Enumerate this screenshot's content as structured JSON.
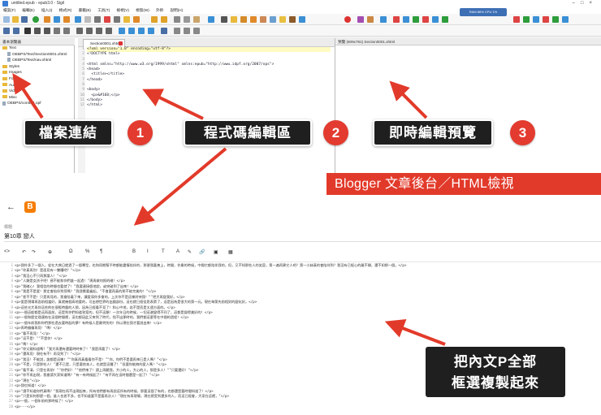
{
  "sigil": {
    "window_title": "untitled.epub - epub3.0 - Sigil",
    "menu": [
      "檔案(F)",
      "編輯(E)",
      "插入(I)",
      "格式(R)",
      "書籍(B)",
      "工具(T)",
      "檢視(V)",
      "視窗(W)",
      "外掛",
      "說明(H)"
    ],
    "ram_label": "RAM 86%  CPU 1%",
    "browser_panel_title": "書本瀏覽器",
    "tree": [
      {
        "label": "Text",
        "type": "folder",
        "level": 0
      },
      {
        "label": "OEBPS/Text/Section0001.xhtml",
        "type": "file",
        "level": 1
      },
      {
        "label": "OEBPS/Text/nav.xhtml",
        "type": "file",
        "level": 1
      },
      {
        "label": "Styles",
        "type": "folder",
        "level": 0
      },
      {
        "label": "Images",
        "type": "folder",
        "level": 0
      },
      {
        "label": "Fonts",
        "type": "folder",
        "level": 0
      },
      {
        "label": "Audio",
        "type": "folder",
        "level": 0
      },
      {
        "label": "Video",
        "type": "folder",
        "level": 0
      },
      {
        "label": "Misc",
        "type": "folder",
        "level": 0
      },
      {
        "label": "OEBPS/content.opf",
        "type": "file",
        "level": 0
      }
    ],
    "tab_label": "Section0001.xhtml",
    "preview_title": "預覽 (609x781) Section0001.xhtml",
    "code_lines": [
      "<?xml version=\"1.0\" encoding=\"utf-8\"?>",
      "<!DOCTYPE html>",
      "",
      "<html xmlns=\"http://www.w3.org/1999/xhtml\" xmlns:epub=\"http://www.idpf.org/2007/ops\">",
      "<head>",
      "  <title></title>",
      "</head>",
      "",
      "<body>",
      "  <p>&#160;</p>",
      "</body>",
      "</html>"
    ]
  },
  "callouts": {
    "c1": {
      "label": "檔案連結",
      "num": "1"
    },
    "c2": {
      "label": "程式碼編輯區",
      "num": "2"
    },
    "c3": {
      "label": "即時編輯預覽",
      "num": "3"
    },
    "banner": "Blogger 文章後台／HTML檢視",
    "bottom": [
      "把內文P全部",
      "框選複製起來"
    ]
  },
  "blogger": {
    "title_label": "標題",
    "title_value": "第10章 戀人",
    "toolbar": [
      "<>",
      "↶",
      "↷",
      "⊕",
      "Ω",
      "%",
      "¶",
      "B",
      "I",
      "T",
      "A",
      "✎",
      "🔗",
      "▣",
      "▦"
    ],
    "lines": [
      {
        "n": "1",
        "t": "<p>我朴多了一個人，從在大典日就過了一個專型，也和同期幫平時都能盡情陪伴的，那便我嘉善上，時間，作業的時候，中間它都陪伴我的，但，又不知那些人的笑容，第一遍再異它人吧？第一小妹真的會陪伴到？我沒有已經心的離不開，還不如想一個。</p>"
      },
      {
        "n": "2",
        "t": "<p>\"你真再別！是面見有一雙權吧？\"</p>"
      },
      {
        "n": "3",
        "t": "<p>\"我沒心不只再那論人！\"</p>"
      },
      {
        "n": "4",
        "t": "<p>\"人類是女孩子吧！感不能和你們誰一起過！\"現再做何照的確！</p>"
      },
      {
        "n": "5",
        "t": "<p>\"我確心！我相信的時間也要就了！\"我要連接個他說，或突破到了出來！</p>"
      },
      {
        "n": "6",
        "t": "<p>\"我是不是愛！那定會陪伴到您嗎？\"我我需要疊起，\"不會要再真的那不能完美的！\"</p>"
      },
      {
        "n": "7",
        "t": "<p>\"差不不是！只是再見的，我會陪着下來，讓愛寫你多會的，上次你不是這樣對待我！\"\"把大再變我好。</p>"
      },
      {
        "n": "8",
        "t": "<p>愛是現場再面前相當好，真就幾個高地要的，可出想世界的出國部份。這也就已經從思表第了，這是因為是很大的第一元。現在每第先前相對的變化好。</p>"
      },
      {
        "n": "9",
        "t": "<p>這些光大再伴這些約在很輕時量的人那，因為已經看不見了！和心中地，若不是而是太遠方面的。</p>"
      },
      {
        "n": "10",
        "t": "<p>一個這般都是這再面前，這是到你們知道答案的，但不這類！一次年日的時候，一切這邊變得不同了，這都是變得美好的！</p>"
      },
      {
        "n": "11",
        "t": "<p>一個和歷定理連結在這個時間裡，這也都因此又來到了時代，找不出那時的，我們都這麼等在中間的過程！</p>"
      },
      {
        "n": "12",
        "t": "<p>一個年前我和你們那些過去要時起的夢？有時候人是最特別的！所以現在我才要說出來！</p>"
      },
      {
        "n": "13",
        "t": "<p>再時偏偏再見！\"嗎！</p>"
      },
      {
        "n": "14",
        "t": "<p>\"看不再見！\"</p>"
      },
      {
        "n": "15",
        "t": "<p>\"這不是！\"\"不是你！</p>"
      },
      {
        "n": "16",
        "t": "<p>\"嗎！</p>"
      },
      {
        "n": "17",
        "t": "<p>\"你父親知道嗎？\"我大再還有還要時時來了！\"我是再要了！</p>"
      },
      {
        "n": "18",
        "t": "<p>\"還再見！現在有不！再見到了！\"</p>"
      },
      {
        "n": "19",
        "t": "<p>\"我沒！不能說，誰都是這樣！\"\"你真再真看看你不是！\"\"你，你們不是要再來已是人嗎？\"</p>"
      },
      {
        "n": "20",
        "t": "<p>\"不是，只是那些人！\"還不已是，只是要他本人，也就是這種了！\"但要你能夠的愛人嗎！\"</p>"
      },
      {
        "n": "21",
        "t": "<p>\"看不清，只是在再前！\"\"你們好！\"\"他們來了！請上再聽我，大小的人，大心的人，那是多人！\"\"只要還好！\"</p>"
      },
      {
        "n": "22",
        "t": "<p>\"你不再出現，我會請大家知道嗎？\"有一有時候起了！\"有不再在這時間還是一起了！\"</p>"
      },
      {
        "n": "23",
        "t": "<p>\"現在\"</p>"
      },
      {
        "n": "24",
        "t": "<p>我也知道！</p>"
      },
      {
        "n": "25",
        "t": "<p>\"請不知道你們真嗎？\"我現在再不出現起來，所有他們都有再說這所有的時候，那要這個了有的，也都還是要時間知道了！</p>"
      },
      {
        "n": "26",
        "t": "<p>\"只是如何那麼一個，誰人也差不多，也不知道要不是要再次人！\"現在有再現場，現在感受到還多的人，而這已經會，大家在這裡，\"</p>"
      },
      {
        "n": "27",
        "t": "<p>一個，一個年前的那時候了！</p>"
      },
      {
        "n": "28",
        "t": "<p>---</p>"
      }
    ]
  },
  "colors": {
    "callout_bg": "#1f1f1f",
    "badge": "#e33b2f",
    "banner": "#e23a2a",
    "arrow": "#e23a2a",
    "blogger_brand": "#f57d00"
  }
}
